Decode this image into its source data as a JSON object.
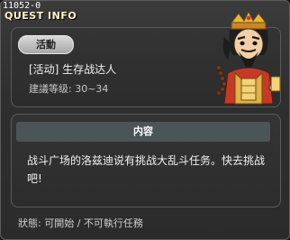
{
  "window": {
    "quest_id": "11052-0",
    "title": "QUEST INFO"
  },
  "quest": {
    "category": "活動",
    "name": "[活动] 生存战达人",
    "level": "建議等级: 30~34"
  },
  "content": {
    "header": "内容",
    "text": "战斗广场的洛兹迪说有挑战大乱斗任务。快去挑战吧!"
  },
  "status": {
    "text": "狀態: 可開始 / 不可執行任務"
  },
  "portrait": {
    "icon": "general-portrait-icon"
  },
  "colors": {
    "background": "#2f2f2f",
    "panel_border": "#5a5a5a",
    "header_bar": "#4b5557",
    "tag": "#b8b8b8",
    "title": "#fff6c8"
  }
}
